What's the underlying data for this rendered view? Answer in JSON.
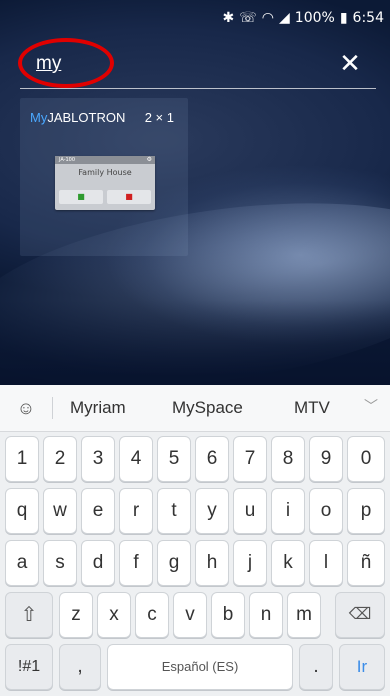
{
  "status_bar": {
    "battery": "100%",
    "time": "6:54",
    "icons": [
      "bluetooth-icon",
      "vibrate-icon",
      "wifi-icon",
      "signal-icon",
      "battery-icon"
    ]
  },
  "search": {
    "query": "my",
    "close_icon": "close-icon"
  },
  "widget": {
    "title_highlight": "My",
    "title_rest": "JABLOTRON",
    "size": "2 × 1",
    "preview": {
      "header": "JA-100",
      "house_name": "Family House"
    }
  },
  "keyboard": {
    "suggestions": [
      "Myriam",
      "MySpace",
      "MTV"
    ],
    "number_row": [
      "1",
      "2",
      "3",
      "4",
      "5",
      "6",
      "7",
      "8",
      "9",
      "0"
    ],
    "row1": [
      "q",
      "w",
      "e",
      "r",
      "t",
      "y",
      "u",
      "i",
      "o",
      "p"
    ],
    "row2": [
      "a",
      "s",
      "d",
      "f",
      "g",
      "h",
      "j",
      "k",
      "l",
      "ñ"
    ],
    "row3": [
      "z",
      "x",
      "c",
      "v",
      "b",
      "n",
      "m"
    ],
    "symbols_key": "!#1",
    "comma_key": ",",
    "space_label": "Español (ES)",
    "period_key": ".",
    "action_key": "Ir"
  },
  "colors": {
    "accent": "#3c8de8",
    "highlight": "#e00000"
  }
}
